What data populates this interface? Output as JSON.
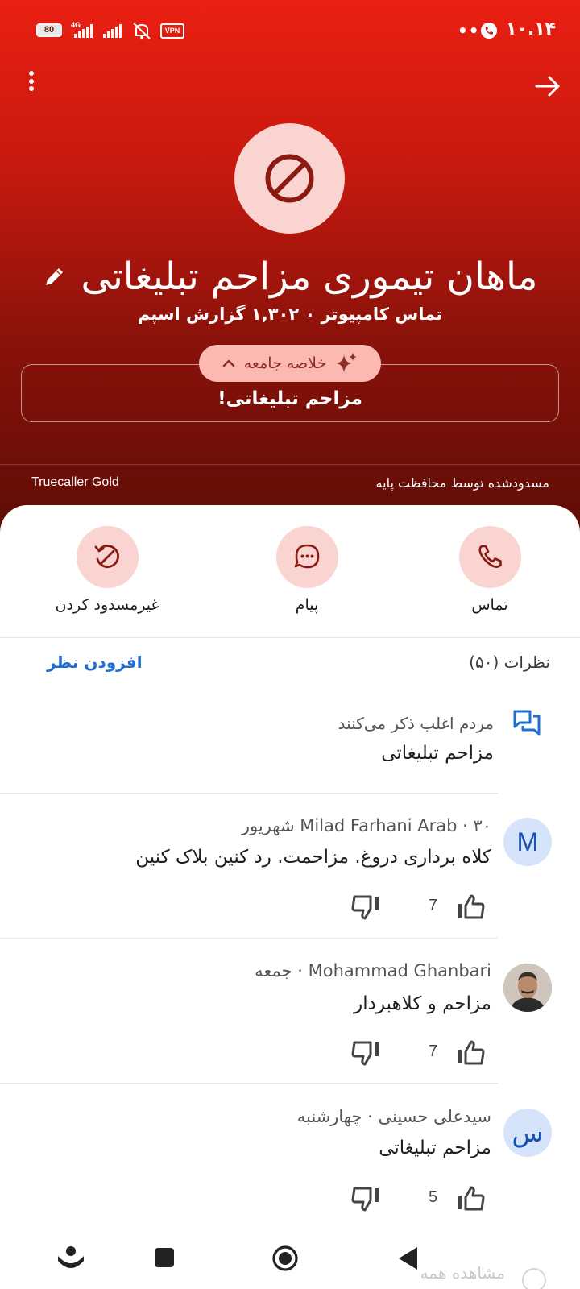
{
  "status_bar": {
    "battery": "80",
    "network": "4G",
    "vpn": "VPN",
    "more": "•••",
    "time": "۱۰.۱۴"
  },
  "contact": {
    "name": "ماهان تیموری مزاحم تبلیغاتی",
    "subtitle": "تماس کامپیوتر ۰ ۱,۳۰۲ گزارش اسپم"
  },
  "summary": {
    "pill_label": "خلاصه جامعه",
    "text": "مزاحم تبلیغاتی!"
  },
  "protection": {
    "blocked_by": "مسدودشده توسط محافظت پایه",
    "tier": "Truecaller Gold"
  },
  "actions": [
    {
      "label": "تماس",
      "icon": "phone-icon"
    },
    {
      "label": "پیام",
      "icon": "message-icon"
    },
    {
      "label": "غیرمسدود کردن",
      "icon": "unblock-icon"
    }
  ],
  "comments_header": {
    "title": "نظرات (۵۰)",
    "add_label": "افزودن نظر"
  },
  "people_mention": {
    "caption": "مردم اغلب ذکر می‌کنند",
    "text": "مزاحم تبلیغاتی"
  },
  "comments": [
    {
      "avatar_letter": "M",
      "meta": "Milad Farhani Arab · ۳۰ شهریور",
      "body": "کلاه برداری دروغ. مزاحمت. رد کنین بلاک کنین",
      "likes": "7"
    },
    {
      "avatar_letter": "",
      "meta": "Mohammad Ghanbari · جمعه",
      "body": "مزاحم و کلاهبردار",
      "likes": "7"
    },
    {
      "avatar_letter": "س",
      "meta": "سیدعلی حسینی · چهارشنبه",
      "body": "مزاحم تبلیغاتی",
      "likes": "5"
    }
  ],
  "footer": {
    "show_all": "مشاهده همه"
  },
  "colors": {
    "hero_top": "#ea1f12",
    "hero_bottom": "#5a0c06",
    "accent_pink": "#fad4d0",
    "icon_dark_red": "#8b1a12",
    "link_blue": "#1f6fd1"
  }
}
